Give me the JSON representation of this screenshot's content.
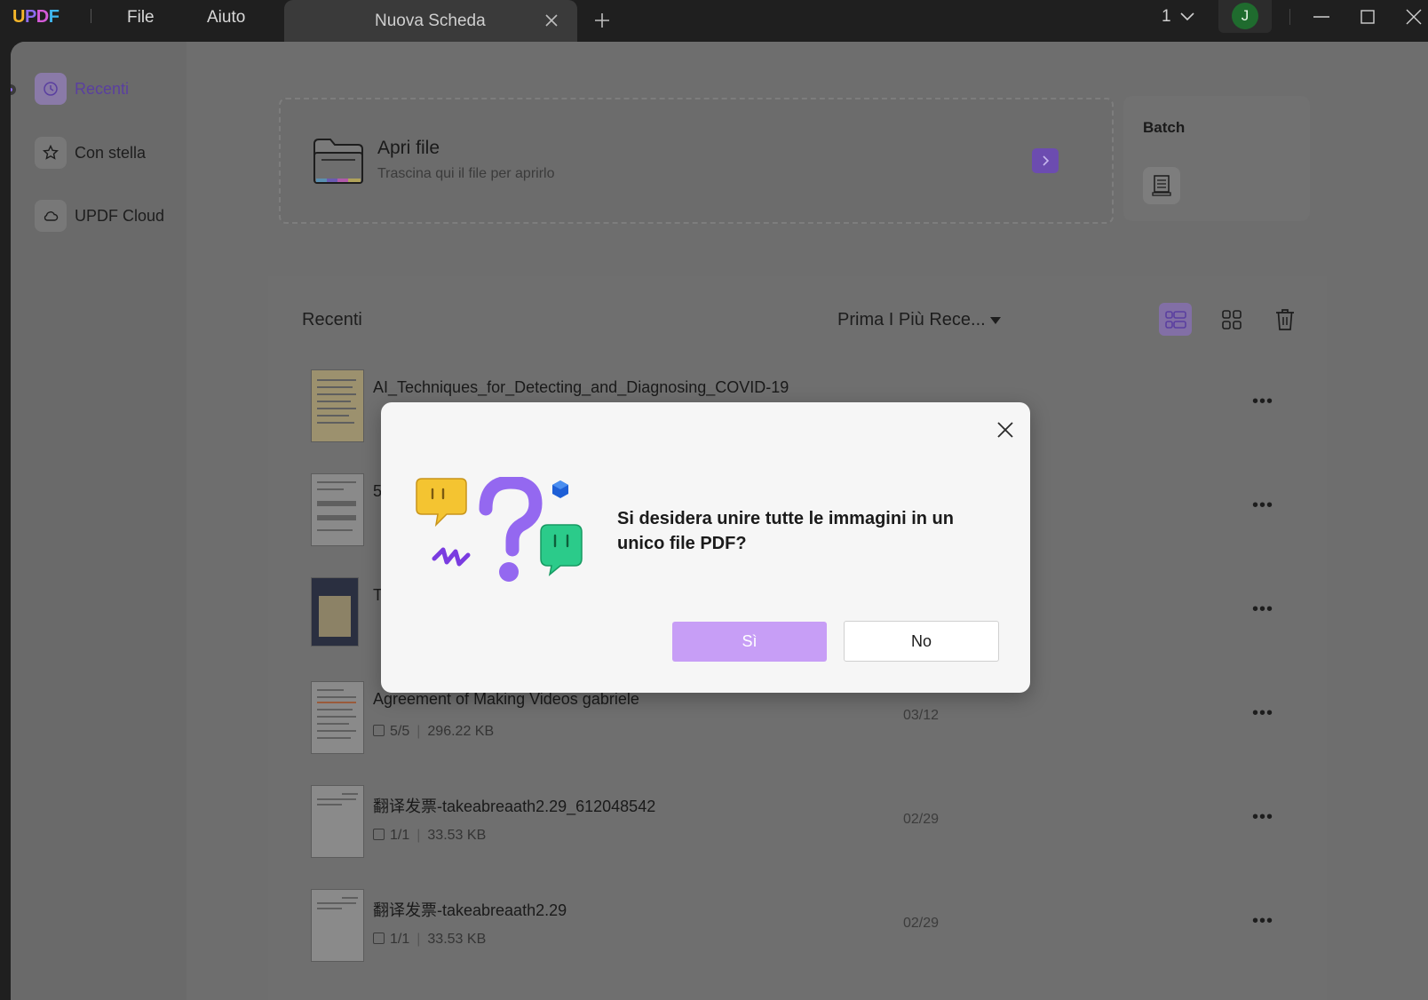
{
  "titlebar": {
    "logo": {
      "u": "U",
      "p": "P",
      "d": "D",
      "f": "F"
    },
    "menu": [
      "File",
      "Aiuto"
    ],
    "tab_title": "Nuova Scheda",
    "page_indicator": "1",
    "avatar_initial": "J"
  },
  "sidebar": {
    "items": [
      {
        "label": "Recenti",
        "icon": "clock-icon",
        "active": true
      },
      {
        "label": "Con stella",
        "icon": "star-icon"
      },
      {
        "label": "UPDF Cloud",
        "icon": "cloud-icon"
      }
    ]
  },
  "open_file": {
    "title": "Apri file",
    "subtitle": "Trascina qui il file per aprirlo"
  },
  "batch": {
    "title": "Batch"
  },
  "recent": {
    "title": "Recenti",
    "sort": "Prima I Più Rece...",
    "files": [
      {
        "name": "AI_Techniques_for_Detecting_and_Diagnosing_COVID-19",
        "pages": "",
        "size": "",
        "date": ""
      },
      {
        "name": "5",
        "pages": "",
        "size": "",
        "date": ""
      },
      {
        "name": "T",
        "pages": "",
        "size": "",
        "date": ""
      },
      {
        "name": "Agreement of Making Videos gabriele",
        "pages": "5/5",
        "size": "296.22 KB",
        "date": "03/12"
      },
      {
        "name": "翻译发票-takeabreaath2.29_612048542",
        "pages": "1/1",
        "size": "33.53 KB",
        "date": "02/29"
      },
      {
        "name": "翻译发票-takeabreaath2.29",
        "pages": "1/1",
        "size": "33.53 KB",
        "date": "02/29"
      }
    ],
    "more_label": "•••"
  },
  "modal": {
    "message": "Si desidera unire tutte le immagini in un unico file PDF?",
    "yes_label": "Sì",
    "no_label": "No"
  },
  "colors": {
    "accent": "#8e6cf0",
    "yes_button": "#c79ef6",
    "avatar": "#1f6b2e"
  }
}
